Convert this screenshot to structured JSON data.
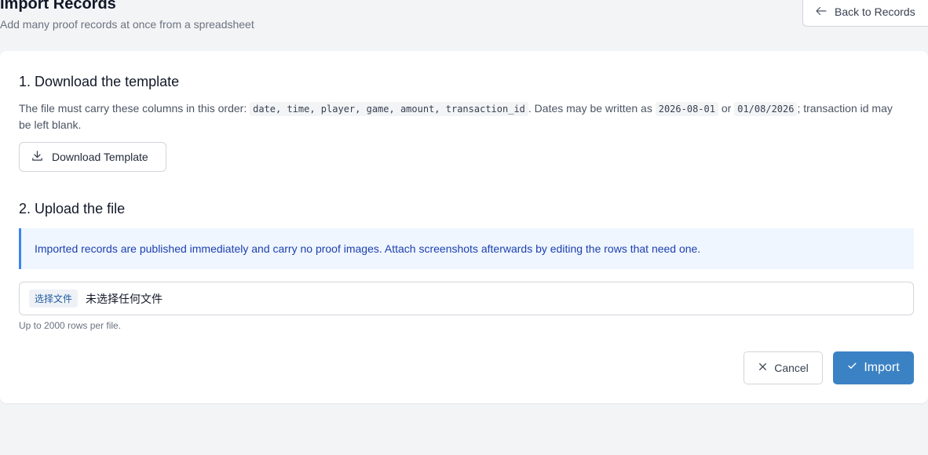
{
  "header": {
    "title": "Import Records",
    "subtitle": "Add many proof records at once from a spreadsheet",
    "back_label": "Back to Records"
  },
  "step1": {
    "title": "1. Download the template",
    "desc_prefix": "The file must carry these columns in this order: ",
    "columns_code": "date, time, player, game, amount, transaction_id",
    "desc_mid": ". Dates may be written as ",
    "date_example_1": "2026-08-01",
    "desc_or": " or ",
    "date_example_2": "01/08/2026",
    "desc_suffix": "; transaction id may be left blank.",
    "download_label": "Download Template"
  },
  "step2": {
    "title": "2. Upload the file",
    "info": "Imported records are published immediately and carry no proof images. Attach screenshots afterwards by editing the rows that need one.",
    "file_choose_label": "选择文件",
    "file_status": "未选择任何文件",
    "hint": "Up to 2000 rows per file."
  },
  "actions": {
    "cancel_label": "Cancel",
    "import_label": "Import"
  },
  "icons": {
    "back": "arrow-left-icon",
    "download": "download-icon",
    "cancel": "close-icon",
    "import": "check-icon"
  },
  "colors": {
    "primary": "#3b82c4",
    "info_bg": "#eff6ff",
    "info_border": "#3b82f6",
    "info_text": "#1e40af"
  }
}
